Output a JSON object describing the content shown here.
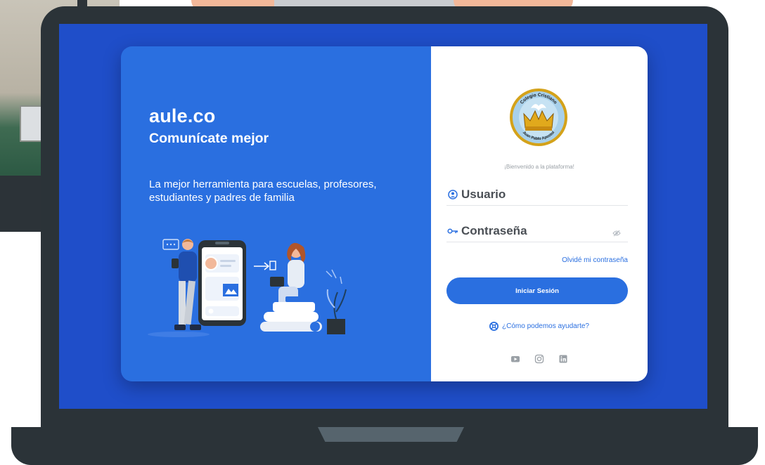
{
  "brand": {
    "name": "aule.co",
    "tagline": "Comunícate mejor",
    "description": "La mejor herramienta para escuelas, profesores, estudiantes y padres de familia"
  },
  "school_logo": {
    "text_top": "Colegio Cristiano",
    "text_bottom": "Juan Pablo Apostol"
  },
  "login": {
    "welcome": "¡Bienvenido a la plataforma!",
    "username_label": "Usuario",
    "password_label": "Contraseña",
    "forgot_password": "Olvidé mi contraseña",
    "submit_label": "Iniciar Sesión",
    "help_link": "¿Cómo podemos ayudarte?"
  },
  "social": [
    "youtube-icon",
    "instagram-icon",
    "linkedin-icon"
  ],
  "colors": {
    "primary": "#2a6fe0",
    "screen": "#1f4ec9",
    "laptop": "#2b3338"
  }
}
